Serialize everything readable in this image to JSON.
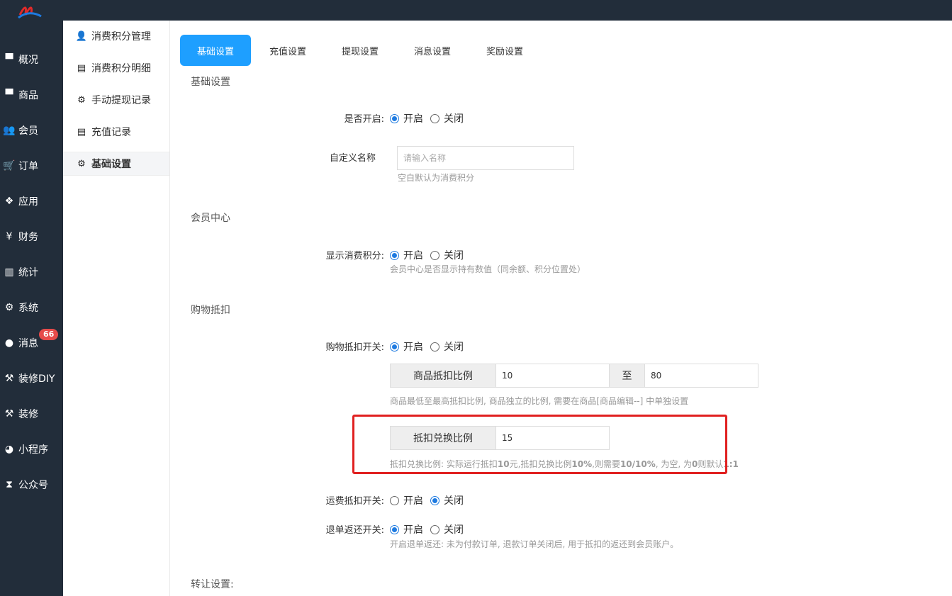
{
  "nav": {
    "items": [
      {
        "label": "概况",
        "icon": "archive-icon"
      },
      {
        "label": "商品",
        "icon": "archive-icon"
      },
      {
        "label": "会员",
        "icon": "users-icon"
      },
      {
        "label": "订单",
        "icon": "cart-icon"
      },
      {
        "label": "应用",
        "icon": "cubes-icon"
      },
      {
        "label": "财务",
        "icon": "yen-icon"
      },
      {
        "label": "统计",
        "icon": "bar-chart-icon"
      },
      {
        "label": "系统",
        "icon": "cogs-icon"
      },
      {
        "label": "消息",
        "icon": "comment-icon",
        "badge": "66"
      },
      {
        "label": "装修DIY",
        "icon": "gavel-icon"
      },
      {
        "label": "装修",
        "icon": "gavel-icon"
      },
      {
        "label": "小程序",
        "icon": "wechat-icon"
      },
      {
        "label": "公众号",
        "icon": "hourglass-icon"
      }
    ]
  },
  "subnav": {
    "items": [
      {
        "label": "消费积分管理",
        "icon": "user-icon"
      },
      {
        "label": "消费积分明细",
        "icon": "file-icon"
      },
      {
        "label": "手动提现记录",
        "icon": "cogs-icon"
      },
      {
        "label": "充值记录",
        "icon": "file-icon"
      },
      {
        "label": "基础设置",
        "icon": "cogs-icon",
        "active": true
      }
    ]
  },
  "tabs": [
    "基础设置",
    "充值设置",
    "提现设置",
    "消息设置",
    "奖励设置"
  ],
  "sections": {
    "basic": "基础设置",
    "member_center": "会员中心",
    "shopping_deduct": "购物抵扣",
    "transfer": "转让设置:"
  },
  "radio": {
    "on": "开启",
    "off": "关闭"
  },
  "form": {
    "enable_label": "是否开启:",
    "custom_name_label": "自定义名称",
    "custom_name_placeholder": "请输入名称",
    "custom_name_hint": "空白默认为消费积分",
    "show_points_label": "显示消费积分:",
    "show_points_hint": "会员中心是否显示持有数值（同余额、积分位置处）",
    "deduct_switch_label": "购物抵扣开关:",
    "goods_ratio_addon": "商品抵扣比例",
    "goods_ratio_min": "10",
    "to_addon": "至",
    "goods_ratio_max": "80",
    "goods_ratio_hint": "商品最低至最高抵扣比例, 商品独立的比例, 需要在商品[商品编辑--] 中单独设置",
    "exchange_ratio_addon": "抵扣兑换比例",
    "exchange_ratio_value": "15",
    "exchange_ratio_hint_a": "抵扣兑换比例: 实际运行抵扣",
    "exchange_ratio_hint_b": "10",
    "exchange_ratio_hint_c": "元,抵扣兑换比例",
    "exchange_ratio_hint_d": "10%",
    "exchange_ratio_hint_e": ",则需要",
    "exchange_ratio_hint_f": "10/10%",
    "exchange_ratio_hint_g": ", 为空, 为",
    "exchange_ratio_hint_h": "0",
    "exchange_ratio_hint_i": "则默认",
    "exchange_ratio_hint_j": "1:1",
    "freight_label": "运费抵扣开关:",
    "refund_label": "退单返还开关:",
    "refund_hint": "开启退单返还: 未为付款订单, 退款订单关闭后, 用于抵扣的返还到会员账户。"
  },
  "colors": {
    "accent": "#1e9fff",
    "sidebar": "#222d3a",
    "highlight": "#e02020",
    "badge": "#e64b4b"
  }
}
